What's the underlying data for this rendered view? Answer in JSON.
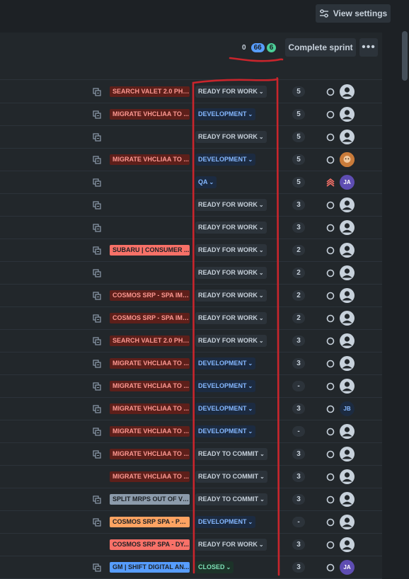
{
  "header": {
    "view_settings_label": "View settings",
    "counts": {
      "todo": "0",
      "in_progress": "66",
      "done": "6"
    },
    "complete_sprint_label": "Complete sprint",
    "more_label": "•••"
  },
  "colors": {
    "background": "#22272b",
    "annotation": "#c9252c"
  },
  "rows": [
    {
      "epic": "SEARCH VALET 2.0 PHA...",
      "epic_color": "red",
      "status": "READY FOR WORK",
      "status_color": "gray",
      "points": "5",
      "subtask": true,
      "priority": "circle",
      "assignee": "default"
    },
    {
      "epic": "MIGRATE VHCLIAA TO ...",
      "epic_color": "red",
      "status": "DEVELOPMENT",
      "status_color": "blue",
      "points": "5",
      "subtask": true,
      "priority": "circle",
      "assignee": "default"
    },
    {
      "epic": "",
      "epic_color": "",
      "status": "READY FOR WORK",
      "status_color": "gray",
      "points": "5",
      "subtask": true,
      "priority": "circle",
      "assignee": "default"
    },
    {
      "epic": "MIGRATE VHCLIAA TO ...",
      "epic_color": "red",
      "status": "DEVELOPMENT",
      "status_color": "blue",
      "points": "5",
      "subtask": true,
      "priority": "circle",
      "assignee": "photo"
    },
    {
      "epic": "",
      "epic_color": "",
      "status": "QA",
      "status_color": "blue",
      "points": "5",
      "subtask": true,
      "priority": "highest",
      "assignee": "JA"
    },
    {
      "epic": "",
      "epic_color": "",
      "status": "READY FOR WORK",
      "status_color": "gray",
      "points": "3",
      "subtask": true,
      "priority": "circle",
      "assignee": "default"
    },
    {
      "epic": "",
      "epic_color": "",
      "status": "READY FOR WORK",
      "status_color": "gray",
      "points": "3",
      "subtask": true,
      "priority": "circle",
      "assignee": "default"
    },
    {
      "epic": "SUBARU | CONSUMER ...",
      "epic_color": "salmon",
      "status": "READY FOR WORK",
      "status_color": "gray",
      "points": "2",
      "subtask": true,
      "priority": "circle",
      "assignee": "default"
    },
    {
      "epic": "",
      "epic_color": "",
      "status": "READY FOR WORK",
      "status_color": "gray",
      "points": "2",
      "subtask": true,
      "priority": "circle",
      "assignee": "default"
    },
    {
      "epic": "COSMOS SRP - SPA IMP...",
      "epic_color": "red",
      "status": "READY FOR WORK",
      "status_color": "gray",
      "points": "2",
      "subtask": true,
      "priority": "circle",
      "assignee": "default"
    },
    {
      "epic": "COSMOS SRP - SPA IMP...",
      "epic_color": "red",
      "status": "READY FOR WORK",
      "status_color": "gray",
      "points": "2",
      "subtask": true,
      "priority": "circle",
      "assignee": "default"
    },
    {
      "epic": "SEARCH VALET 2.0 PHA...",
      "epic_color": "red",
      "status": "READY FOR WORK",
      "status_color": "gray",
      "points": "3",
      "subtask": true,
      "priority": "circle",
      "assignee": "default"
    },
    {
      "epic": "MIGRATE VHCLIAA TO ...",
      "epic_color": "red",
      "status": "DEVELOPMENT",
      "status_color": "blue",
      "points": "3",
      "subtask": true,
      "priority": "circle",
      "assignee": "default"
    },
    {
      "epic": "MIGRATE VHCLIAA TO ...",
      "epic_color": "red",
      "status": "DEVELOPMENT",
      "status_color": "blue",
      "points": "-",
      "subtask": true,
      "priority": "circle",
      "assignee": "default"
    },
    {
      "epic": "MIGRATE VHCLIAA TO ...",
      "epic_color": "red",
      "status": "DEVELOPMENT",
      "status_color": "blue",
      "points": "3",
      "subtask": true,
      "priority": "circle",
      "assignee": "JB"
    },
    {
      "epic": "MIGRATE VHCLIAA TO ...",
      "epic_color": "red",
      "status": "DEVELOPMENT",
      "status_color": "blue",
      "points": "-",
      "subtask": true,
      "priority": "circle",
      "assignee": "default"
    },
    {
      "epic": "MIGRATE VHCLIAA TO ...",
      "epic_color": "red",
      "status": "READY TO COMMIT",
      "status_color": "gray",
      "points": "3",
      "subtask": true,
      "priority": "circle",
      "assignee": "default"
    },
    {
      "epic": "MIGRATE VHCLIAA TO ...",
      "epic_color": "red",
      "status": "READY TO COMMIT",
      "status_color": "gray",
      "points": "3",
      "subtask": false,
      "priority": "circle",
      "assignee": "default"
    },
    {
      "epic": "SPLIT MRPS OUT OF VH...",
      "epic_color": "gray",
      "status": "READY TO COMMIT",
      "status_color": "gray",
      "points": "3",
      "subtask": true,
      "priority": "circle",
      "assignee": "default"
    },
    {
      "epic": "COSMOS SRP SPA - PER...",
      "epic_color": "orange",
      "status": "DEVELOPMENT",
      "status_color": "blue",
      "points": "-",
      "subtask": true,
      "priority": "circle",
      "assignee": "default"
    },
    {
      "epic": "COSMOS SRP SPA - DY...",
      "epic_color": "salmon",
      "status": "READY FOR WORK",
      "status_color": "gray",
      "points": "3",
      "subtask": false,
      "priority": "circle",
      "assignee": "default"
    },
    {
      "epic": "GM | SHIFT DIGITAL AN...",
      "epic_color": "blue",
      "status": "CLOSED",
      "status_color": "green",
      "points": "3",
      "subtask": true,
      "priority": "circle",
      "assignee": "JA"
    }
  ]
}
